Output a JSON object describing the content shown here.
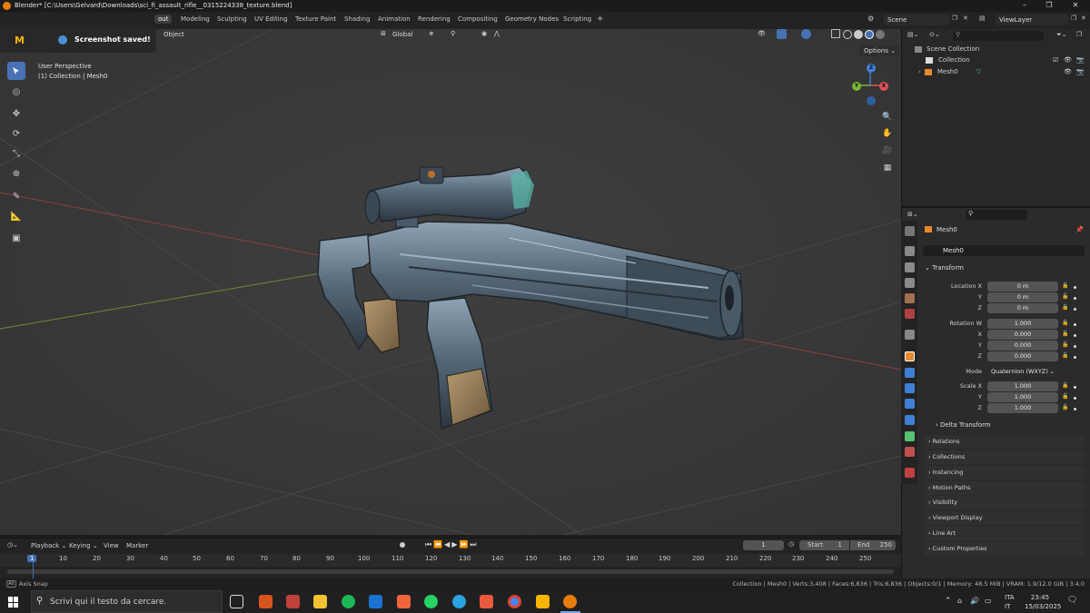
{
  "window": {
    "title": "Blender* [C:\\Users\\Gelvard\\Downloads\\sci_fi_assault_rifle__0315224338_texture.blend]"
  },
  "notification": {
    "text": "Screenshot saved!"
  },
  "workspaces": [
    "Layout",
    "Modeling",
    "Sculpting",
    "UV Editing",
    "Texture Paint",
    "Shading",
    "Animation",
    "Rendering",
    "Compositing",
    "Geometry Nodes",
    "Scripting"
  ],
  "active_workspace_visible": "out",
  "scene": {
    "name": "Scene",
    "view_layer": "ViewLayer"
  },
  "viewport": {
    "header_object": "Object",
    "orientation": "Global",
    "options": "Options",
    "perspective": "User Perspective",
    "collection_info": "(1) Collection | Mesh0",
    "gizmo": {
      "x": "X",
      "y": "Y",
      "z": "Z"
    }
  },
  "outliner": {
    "search_placeholder": "",
    "scene_collection": "Scene Collection",
    "collection": "Collection",
    "mesh": "Mesh0"
  },
  "properties": {
    "object_name": "Mesh0",
    "data_name": "Mesh0",
    "transform": "Transform",
    "location": {
      "label_x": "Location X",
      "label_y": "Y",
      "label_z": "Z",
      "x": "0 m",
      "y": "0 m",
      "z": "0 m"
    },
    "rotation": {
      "label_w": "Rotation W",
      "label_x": "X",
      "label_y": "Y",
      "label_z": "Z",
      "w": "1.000",
      "x": "0.000",
      "y": "0.000",
      "z": "0.000"
    },
    "mode_label": "Mode",
    "mode_value": "Quaternion (WXYZ)",
    "scale": {
      "label_x": "Scale X",
      "label_y": "Y",
      "label_z": "Z",
      "x": "1.000",
      "y": "1.000",
      "z": "1.000"
    },
    "delta_transform": "Delta Transform",
    "panels": [
      "Relations",
      "Collections",
      "Instancing",
      "Motion Paths",
      "Visibility",
      "Viewport Display",
      "Line Art",
      "Custom Properties"
    ]
  },
  "timeline": {
    "menus": [
      "Playback",
      "Keying",
      "View",
      "Marker"
    ],
    "current_frame": "1",
    "start_label": "Start",
    "start": "1",
    "end_label": "End",
    "end": "250",
    "ruler": [
      "1",
      "10",
      "20",
      "30",
      "40",
      "50",
      "60",
      "70",
      "80",
      "90",
      "100",
      "110",
      "120",
      "130",
      "140",
      "150",
      "160",
      "170",
      "180",
      "190",
      "200",
      "210",
      "220",
      "230",
      "240",
      "250"
    ]
  },
  "status": {
    "left": "Axis Snap",
    "right": "Collection | Mesh0 | Verts:3,408 | Faces:6,836 | Tris:6,836 | Objects:0/1 | Memory: 48.5 MiB | VRAM: 1.9/12.0 GiB | 3.4.0"
  },
  "taskbar": {
    "search_placeholder": "Scrivi qui il testo da cercare.",
    "lang1": "ITA",
    "lang2": "IT",
    "time": "23:45",
    "date": "15/03/2025"
  },
  "colors": {
    "accent": "#4772b3",
    "brand_orange": "#e87d0d",
    "x_axis": "#e0525a",
    "y_axis": "#7ab632",
    "z_axis": "#3f7fd7"
  }
}
